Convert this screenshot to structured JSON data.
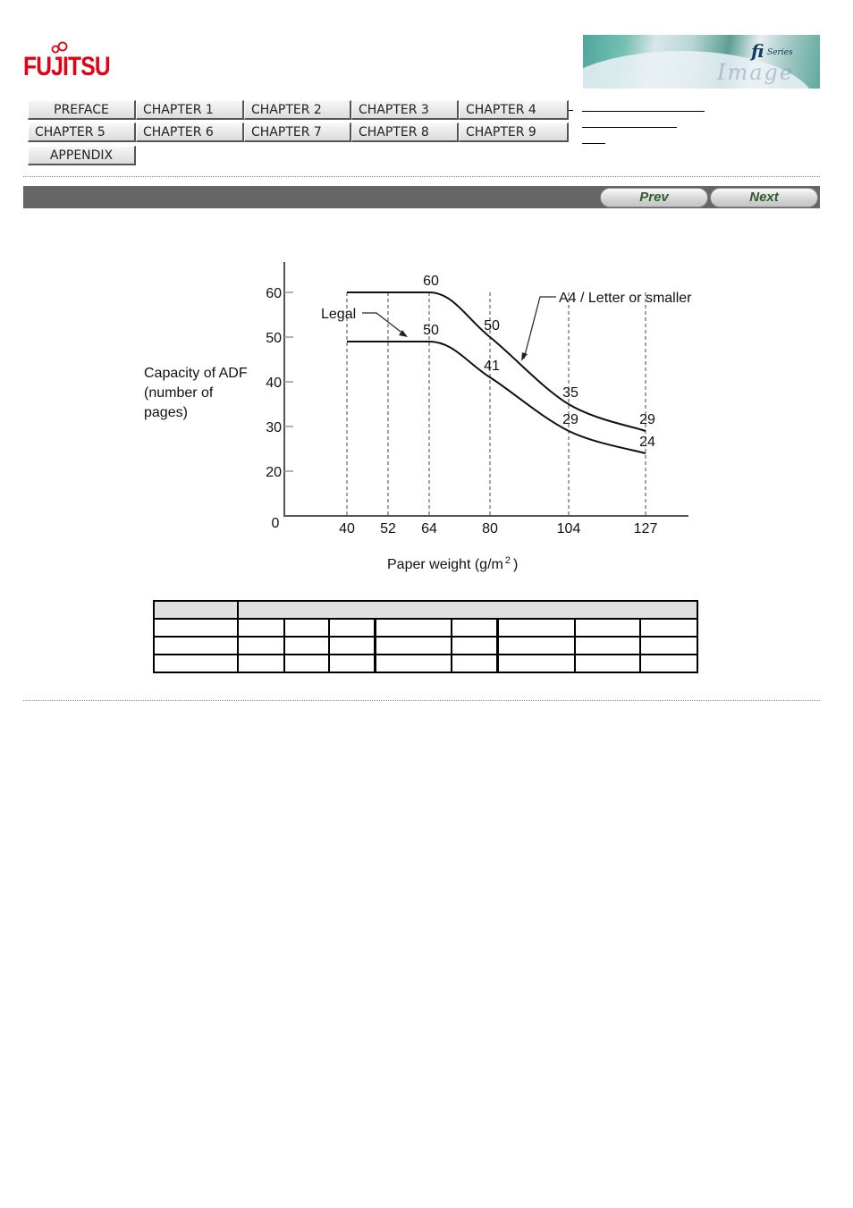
{
  "brand": {
    "logo_text": "FUJITSU",
    "logo_color": "#e60012",
    "banner_text": "fi",
    "banner_subtext": "Series",
    "banner_faint_text": "Image Scanner"
  },
  "nav": {
    "rows": [
      [
        "PREFACE",
        "CHAPTER 1",
        "CHAPTER 2",
        "CHAPTER 3",
        "CHAPTER 4"
      ],
      [
        "CHAPTER 5",
        "CHAPTER 6",
        "CHAPTER 7",
        "CHAPTER 8",
        "CHAPTER 9"
      ],
      [
        "APPENDIX"
      ]
    ]
  },
  "toolbar": {
    "prev_label": "Prev",
    "next_label": "Next",
    "bar_color": "#666666",
    "button_text_color": "#2e5e2e"
  },
  "chart_data": {
    "type": "line",
    "title": "",
    "xlabel": "Paper weight (g/m",
    "xlabel_sup": "2",
    "xlabel_close": ")",
    "ylabel_lines": [
      "Capacity of ADF",
      "(number of",
      "pages)"
    ],
    "x_ticks": [
      40,
      52,
      64,
      80,
      104,
      127
    ],
    "y_ticks": [
      0,
      20,
      30,
      40,
      50,
      60
    ],
    "origin_label": "0",
    "ylim": [
      0,
      60
    ],
    "grid": false,
    "guide_lines": "dashed vertical lines at each x tick",
    "series": [
      {
        "name": "A4 / Letter or smaller",
        "x": [
          40,
          64,
          80,
          104,
          127
        ],
        "values": [
          60,
          60,
          50,
          35,
          29
        ],
        "point_labels": [
          {
            "x": 64,
            "label": "60"
          },
          {
            "x": 80,
            "label": "50"
          },
          {
            "x": 104,
            "label": "35"
          },
          {
            "x": 127,
            "label": "29"
          }
        ]
      },
      {
        "name": "Legal",
        "x": [
          40,
          64,
          80,
          104,
          127
        ],
        "values": [
          49,
          49,
          41,
          29,
          24
        ],
        "point_labels": [
          {
            "x": 64,
            "label": "50"
          },
          {
            "x": 80,
            "label": "41"
          },
          {
            "x": 104,
            "label": "29"
          },
          {
            "x": 127,
            "label": "24"
          }
        ]
      }
    ],
    "annotations": [
      {
        "text": "A4 / Letter or smaller",
        "points_to": "A4 / Letter or smaller"
      },
      {
        "text": "Legal",
        "points_to": "Legal"
      }
    ]
  },
  "table": {
    "header_fill": "#e0e0e0",
    "rows": 3,
    "columns": 9,
    "cells": []
  }
}
